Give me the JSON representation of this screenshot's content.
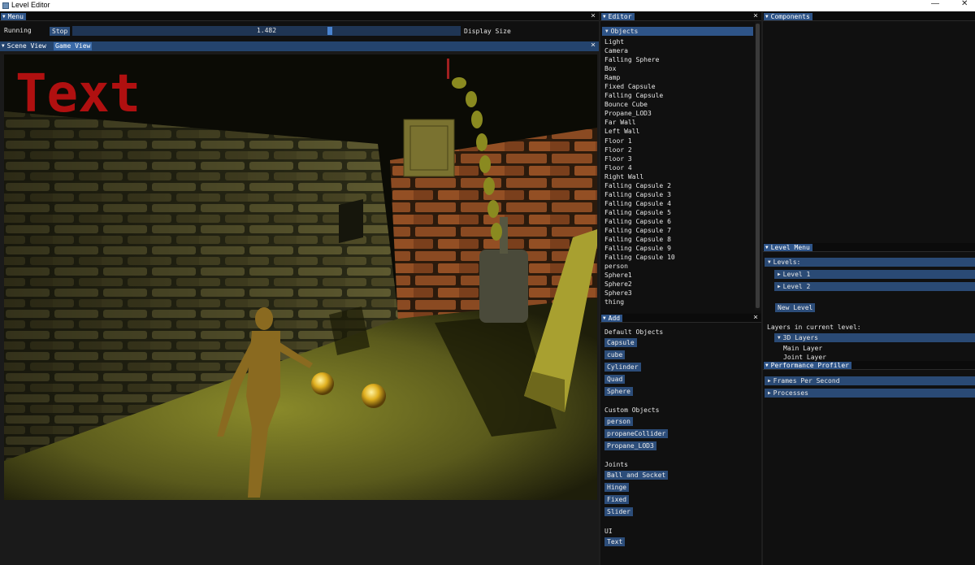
{
  "os": {
    "title": "Level Editor",
    "minimize": "—",
    "close": "✕"
  },
  "menu": {
    "tab": "Menu",
    "status": "Running",
    "stop_label": "Stop",
    "slider_value": "1.482",
    "slider_fraction": 0.665,
    "display_size_label": "Display Size"
  },
  "scene": {
    "tab_scene": "Scene View",
    "tab_game": "Game View",
    "overlay_text": "Text"
  },
  "editor": {
    "tab": "Editor",
    "objects_header": "Objects",
    "objects": [
      "Light",
      "Camera",
      "Falling Sphere",
      "Box",
      "Ramp",
      "Fixed Capsule",
      "Falling Capsule",
      "Bounce Cube",
      "Propane_LOD3",
      "Far Wall",
      "Left Wall",
      "Floor 1",
      "Floor 2",
      "Floor 3",
      "Floor 4",
      "Right Wall",
      "Falling Capsule 2",
      "Falling Capsule 3",
      "Falling Capsule 4",
      "Falling Capsule 5",
      "Falling Capsule 6",
      "Falling Capsule 7",
      "Falling Capsule 8",
      "Falling Capsule 9",
      "Falling Capsule 10",
      "person",
      "Sphere1",
      "Sphere2",
      "Sphere3",
      "thing"
    ]
  },
  "add": {
    "tab": "Add",
    "default_heading": "Default Objects",
    "default_items": [
      "Capsule",
      "cube",
      "Cylinder",
      "Quad",
      "Sphere"
    ],
    "custom_heading": "Custom Objects",
    "custom_items": [
      "person",
      "propaneCollider",
      "Propane_LOD3"
    ],
    "joints_heading": "Joints",
    "joint_items": [
      "Ball and Socket",
      "Hinge",
      "Fixed",
      "Slider"
    ],
    "ui_heading": "UI",
    "ui_items": [
      "Text"
    ]
  },
  "components": {
    "tab": "Components"
  },
  "level_menu": {
    "tab": "Level Menu",
    "levels_header": "Levels:",
    "levels": [
      "Level 1",
      "Level 2"
    ],
    "new_level_label": "New Level",
    "layers_heading": "Layers in current level:",
    "layers_group": "3D Layers",
    "layers": [
      "Main Layer",
      "Joint Layer"
    ]
  },
  "profiler": {
    "tab": "Performance Profiler",
    "items": [
      "Frames Per Second",
      "Processes"
    ]
  }
}
